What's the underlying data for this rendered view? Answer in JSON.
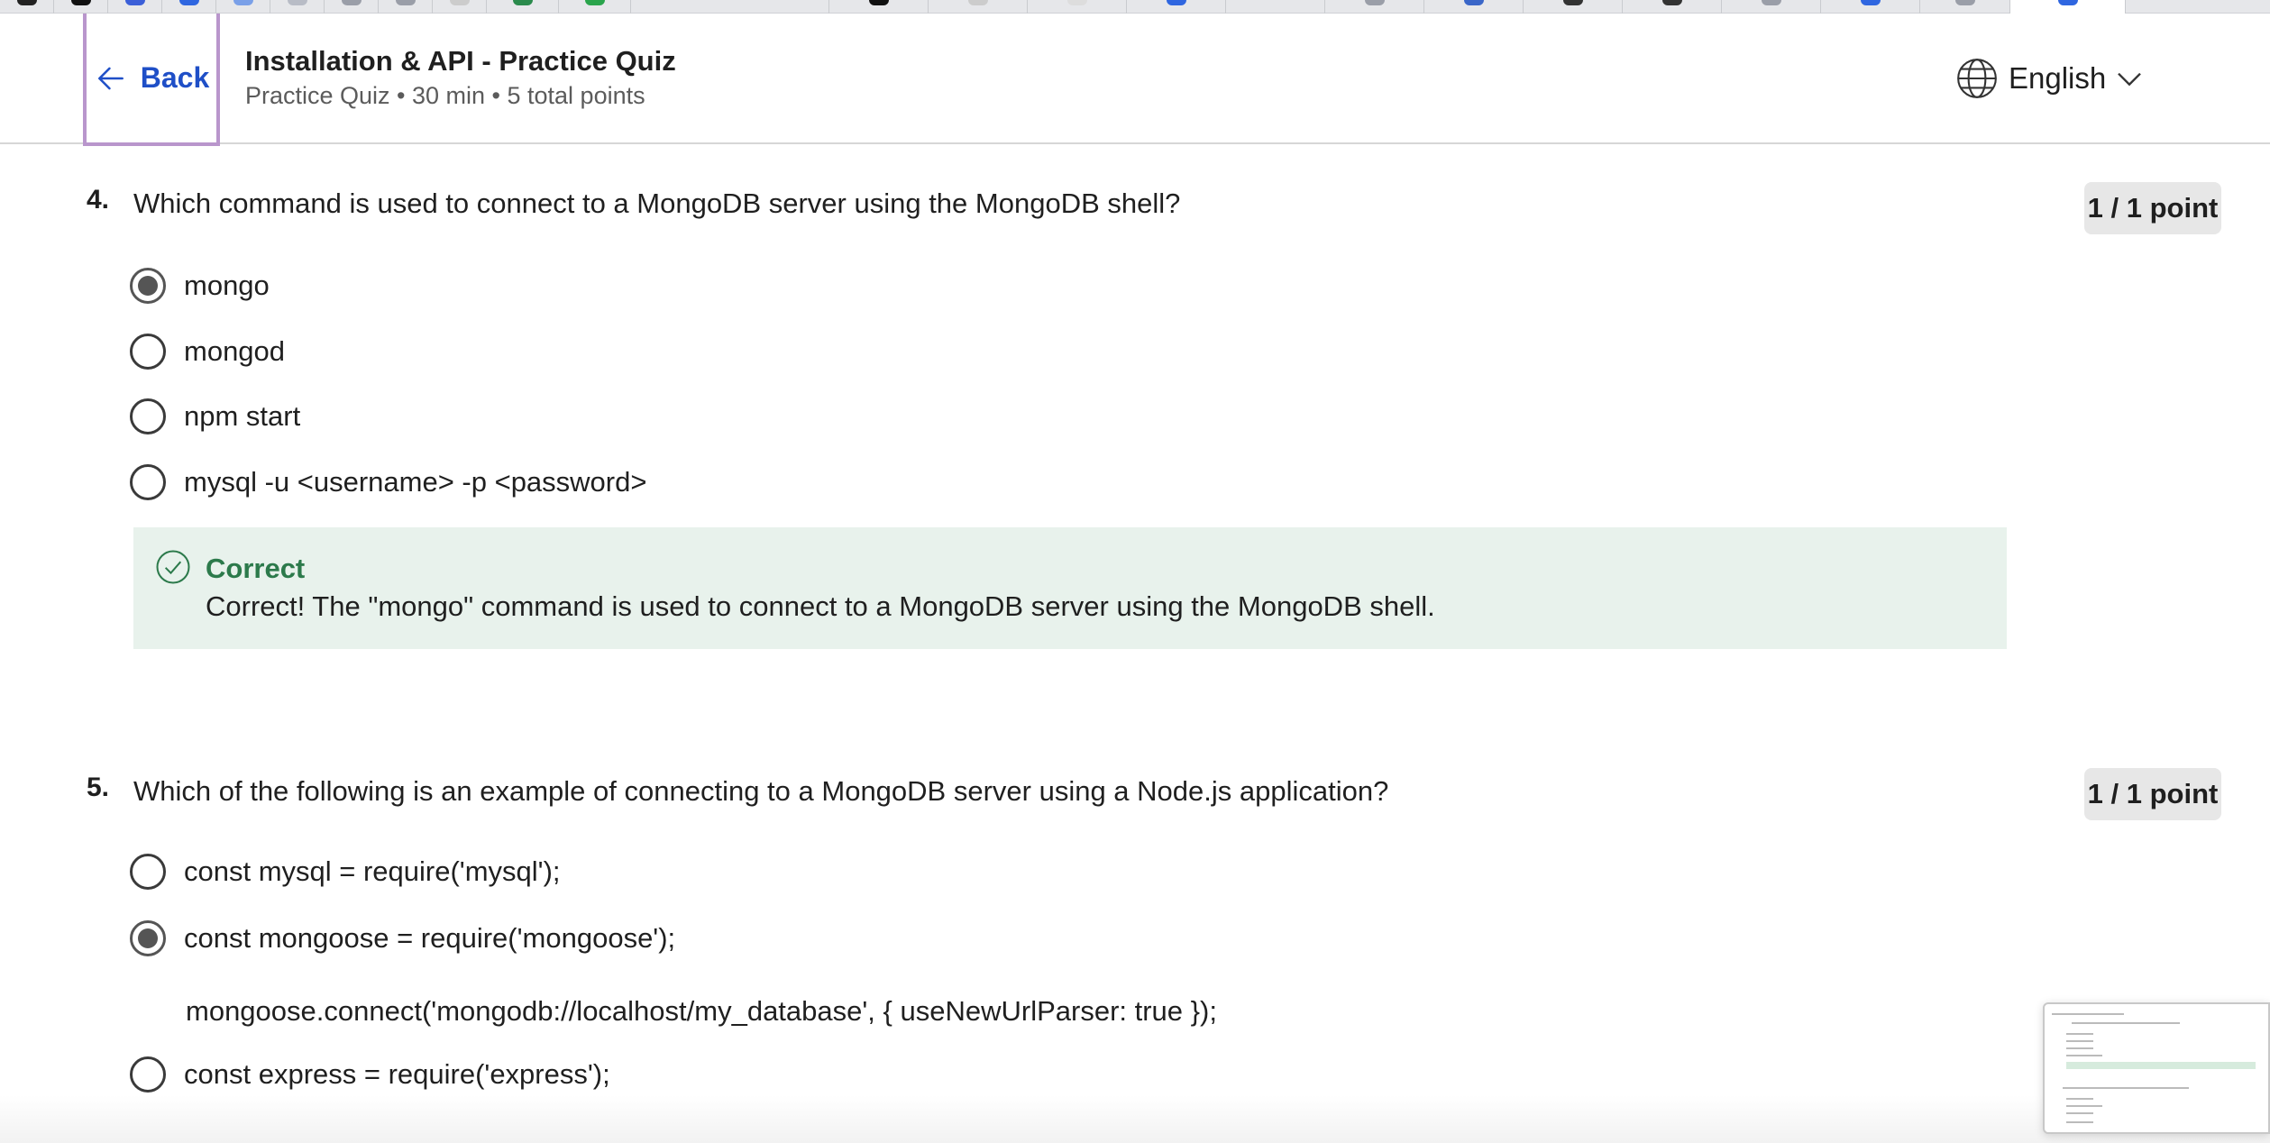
{
  "header": {
    "back_label": "Back",
    "title": "Installation & API - Practice Quiz",
    "meta": "Practice Quiz • 30 min • 5 total points",
    "language": "English"
  },
  "questions": [
    {
      "number": "4.",
      "text": "Which command is used to connect to a MongoDB server using the MongoDB shell?",
      "points": "1 / 1 point",
      "options": [
        {
          "label": "mongo",
          "selected": true
        },
        {
          "label": "mongod",
          "selected": false
        },
        {
          "label": "npm start",
          "selected": false
        },
        {
          "label": "mysql -u <username> -p <password>",
          "selected": false
        }
      ],
      "feedback": {
        "title": "Correct",
        "text": "Correct! The \"mongo\" command is used to connect to a MongoDB server using the MongoDB shell."
      }
    },
    {
      "number": "5.",
      "text": "Which of the following is an example of connecting to a MongoDB server using a Node.js application?",
      "points": "1 / 1 point",
      "options": [
        {
          "label": "const mysql = require('mysql');",
          "selected": false
        },
        {
          "label": "const mongoose = require('mongoose');",
          "continuation": "mongoose.connect('mongodb://localhost/my_database', { useNewUrlParser: true });",
          "selected": true
        },
        {
          "label": "const express = require('express');",
          "selected": false
        }
      ]
    }
  ],
  "colors": {
    "accent_link": "#1f4fc7",
    "correct_green": "#2c7a4b",
    "feedback_bg": "#e8f2ec",
    "focus_outline": "#b996cc"
  },
  "icons": {
    "back": "arrow-left-icon",
    "language": "globe-icon",
    "dropdown": "chevron-down-icon",
    "correct": "check-circle-icon"
  }
}
